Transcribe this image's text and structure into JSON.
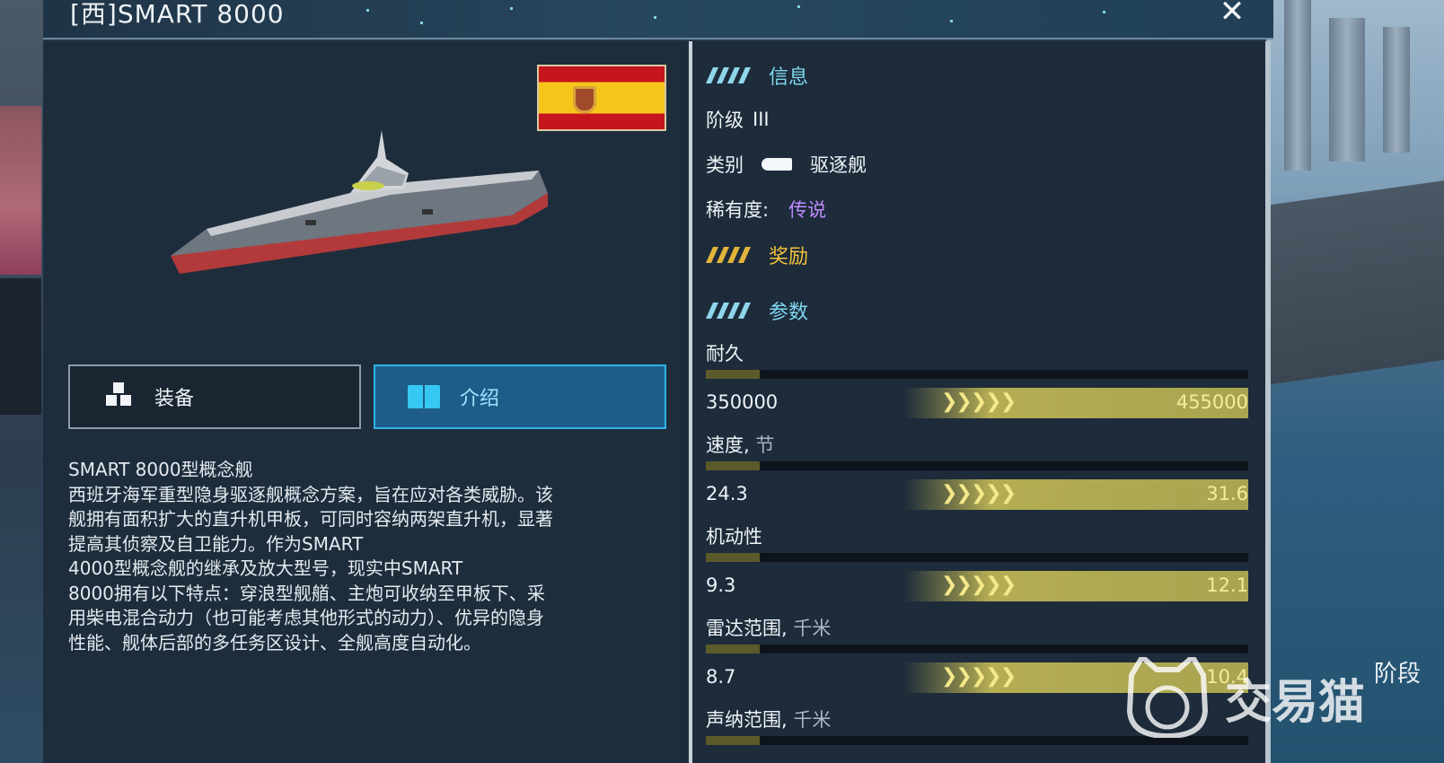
{
  "header": {
    "title": "[西]SMART 8000",
    "close_label": "✕"
  },
  "flag": {
    "country": "Spain",
    "colors": [
      "#c5161e",
      "#f6c51c"
    ]
  },
  "tabs": [
    {
      "label": "装备",
      "icon": "cubes-icon",
      "active": false
    },
    {
      "label": "介绍",
      "icon": "book-icon",
      "active": true
    }
  ],
  "description": {
    "lines": [
      "SMART 8000型概念舰",
      "西班牙海军重型隐身驱逐舰概念方案，旨在应对各类威胁。该",
      "舰拥有面积扩大的直升机甲板，可同时容纳两架直升机，显著",
      "提高其侦察及自卫能力。作为SMART",
      "4000型概念舰的继承及放大型号，现实中SMART",
      "8000拥有以下特点：穿浪型舰艏、主炮可收纳至甲板下、采",
      "用柴电混合动力（也可能考虑其他形式的动力）、优异的隐身",
      "性能、舰体后部的多任务区设计、全舰高度自动化。"
    ]
  },
  "info": {
    "section_title": "信息",
    "tier_label": "阶级",
    "tier_value": "III",
    "class_label": "类别",
    "class_value": "驱逐舰",
    "rarity_label": "稀有度:",
    "rarity_value": "传说",
    "rarity_color": "#c08cff"
  },
  "rewards": {
    "section_title": "奖励",
    "color": "#f2c33a"
  },
  "params": {
    "section_title": "参数",
    "stats": [
      {
        "label": "耐久",
        "unit": "",
        "current": "350000",
        "max": "455000",
        "fill": 0.1
      },
      {
        "label": "速度,",
        "unit": "节",
        "current": "24.3",
        "max": "31.6",
        "fill": 0.1
      },
      {
        "label": "机动性",
        "unit": "",
        "current": "9.3",
        "max": "12.1",
        "fill": 0.1
      },
      {
        "label": "雷达范围,",
        "unit": "千米",
        "current": "8.7",
        "max": "10.4",
        "fill": 0.1
      },
      {
        "label": "声纳范围,",
        "unit": "千米",
        "current": "",
        "max": "",
        "fill": 0.1
      }
    ],
    "chevrons": "❯❯❯❯❯"
  },
  "side": {
    "stage_label": "阶段"
  },
  "watermark": {
    "text": "交易猫"
  }
}
